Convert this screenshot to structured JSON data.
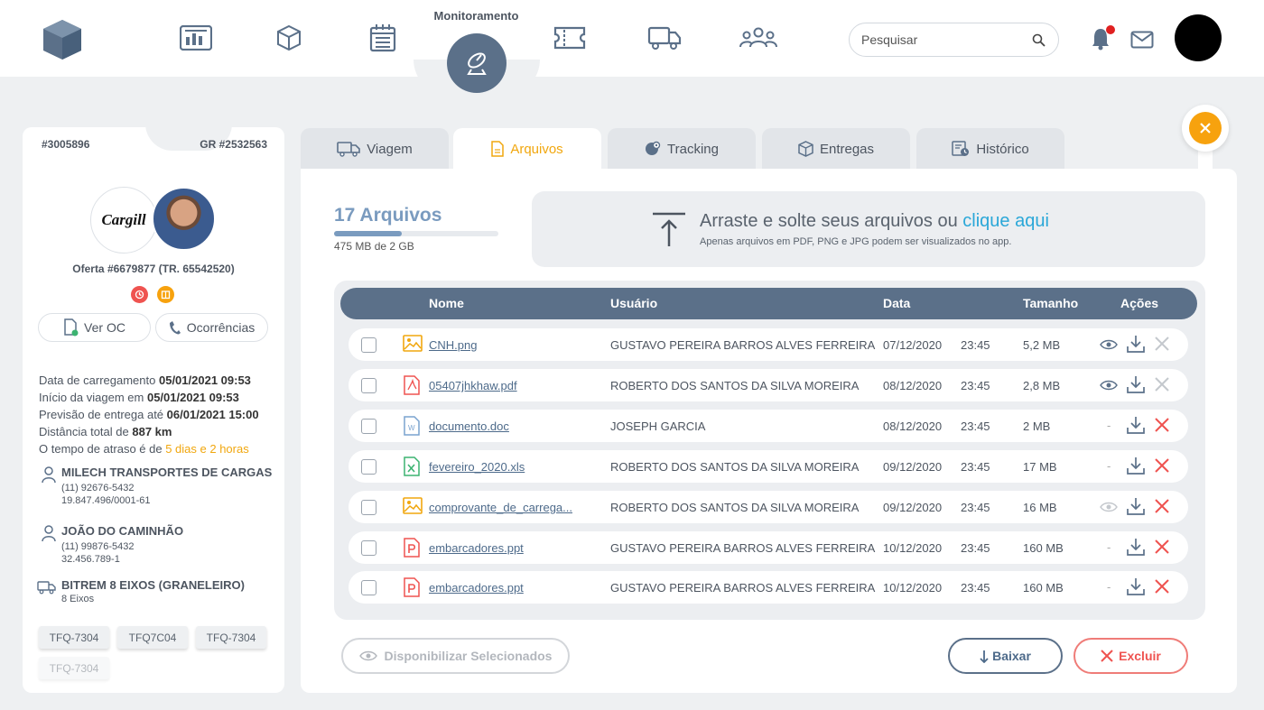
{
  "header": {
    "nav_active_label": "Monitoramento",
    "search_placeholder": "Pesquisar",
    "nav_icons": [
      "dashboard-icon",
      "box-icon",
      "calendar-icon",
      "monitoring-satellite-icon",
      "ticket-icon",
      "truck-icon",
      "users-icon"
    ]
  },
  "card": {
    "order_id": "#3005896",
    "gr_id": "GR #2532563",
    "company_logo_text": "Cargill",
    "offer": "Oferta #6679877 (TR. 65542520)",
    "btn_ver_oc": "Ver OC",
    "btn_ocorrencias": "Ocorrências",
    "info": {
      "load_label": "Data de carregamento",
      "load_value": "05/01/2021 09:53",
      "start_label": "Início da viagem em",
      "start_value": "05/01/2021 09:53",
      "eta_label": "Previsão de entrega até",
      "eta_value": "06/01/2021 15:00",
      "distance_label": "Distância total de",
      "distance_value": "887 km",
      "delay_label": "O tempo de atraso é de",
      "delay_value": "5 dias e 2 horas"
    },
    "carrier": {
      "name": "MILECH TRANSPORTES DE CARGAS",
      "phone": "(11) 92676-5432",
      "doc": "19.847.496/0001-61"
    },
    "driver": {
      "name": "JOÃO DO CAMINHÃO",
      "phone": "(11) 99876-5432",
      "doc": "32.456.789-1"
    },
    "vehicle": {
      "name": "BITREM 8 EIXOS (GRANELEIRO)",
      "axles": "8 Eixos"
    },
    "plates": [
      "TFQ-7304",
      "TFQ7C04",
      "TFQ-7304",
      "TFQ-7304"
    ]
  },
  "tabs": [
    "Viagem",
    "Arquivos",
    "Tracking",
    "Entregas",
    "Histórico"
  ],
  "files": {
    "count_label": "17 Arquivos",
    "quota_label": "475 MB de 2 GB",
    "quota_fraction": 0.41,
    "drop_text": "Arraste e solte seus arquivos ou",
    "drop_link": "clique aqui",
    "drop_hint": "Apenas arquivos em PDF, PNG e JPG podem ser visualizados no app.",
    "columns": {
      "name": "Nome",
      "user": "Usuário",
      "date": "Data",
      "size": "Tamanho",
      "actions": "Ações"
    },
    "rows": [
      {
        "name": "CNH.png",
        "type": "image",
        "user": "GUSTAVO PEREIRA BARROS ALVES FERREIRA",
        "date": "07/12/2020",
        "time": "23:45",
        "size": "5,2 MB",
        "view": "eye",
        "delete_active": false
      },
      {
        "name": "05407jhkhaw.pdf",
        "type": "pdf",
        "user": "ROBERTO DOS SANTOS DA SILVA MOREIRA",
        "date": "08/12/2020",
        "time": "23:45",
        "size": "2,8 MB",
        "view": "eye",
        "delete_active": false
      },
      {
        "name": "documento.doc",
        "type": "doc",
        "user": "JOSEPH GARCIA",
        "date": "08/12/2020",
        "time": "23:45",
        "size": "2 MB",
        "view": "-",
        "delete_active": true
      },
      {
        "name": "fevereiro_2020.xls",
        "type": "xls",
        "user": "ROBERTO DOS SANTOS DA SILVA MOREIRA",
        "date": "09/12/2020",
        "time": "23:45",
        "size": "17 MB",
        "view": "-",
        "delete_active": true
      },
      {
        "name": "comprovante_de_carrega...",
        "type": "image",
        "user": "ROBERTO DOS SANTOS DA SILVA MOREIRA",
        "date": "09/12/2020",
        "time": "23:45",
        "size": "16 MB",
        "view": "eye-faded",
        "delete_active": true
      },
      {
        "name": "embarcadores.ppt",
        "type": "ppt",
        "user": "GUSTAVO PEREIRA BARROS ALVES FERREIRA",
        "date": "10/12/2020",
        "time": "23:45",
        "size": "160 MB",
        "view": "-",
        "delete_active": true
      },
      {
        "name": "embarcadores.ppt",
        "type": "ppt",
        "user": "GUSTAVO PEREIRA BARROS ALVES FERREIRA",
        "date": "10/12/2020",
        "time": "23:45",
        "size": "160 MB",
        "view": "-",
        "delete_active": true
      }
    ],
    "btn_avail": "Disponibilizar Selecionados",
    "btn_download": "Baixar",
    "btn_delete": "Excluir"
  },
  "colors": {
    "accent": "#f1a70e",
    "primary": "#5b7089",
    "link": "#2aa7d8",
    "danger": "#ef5350"
  }
}
